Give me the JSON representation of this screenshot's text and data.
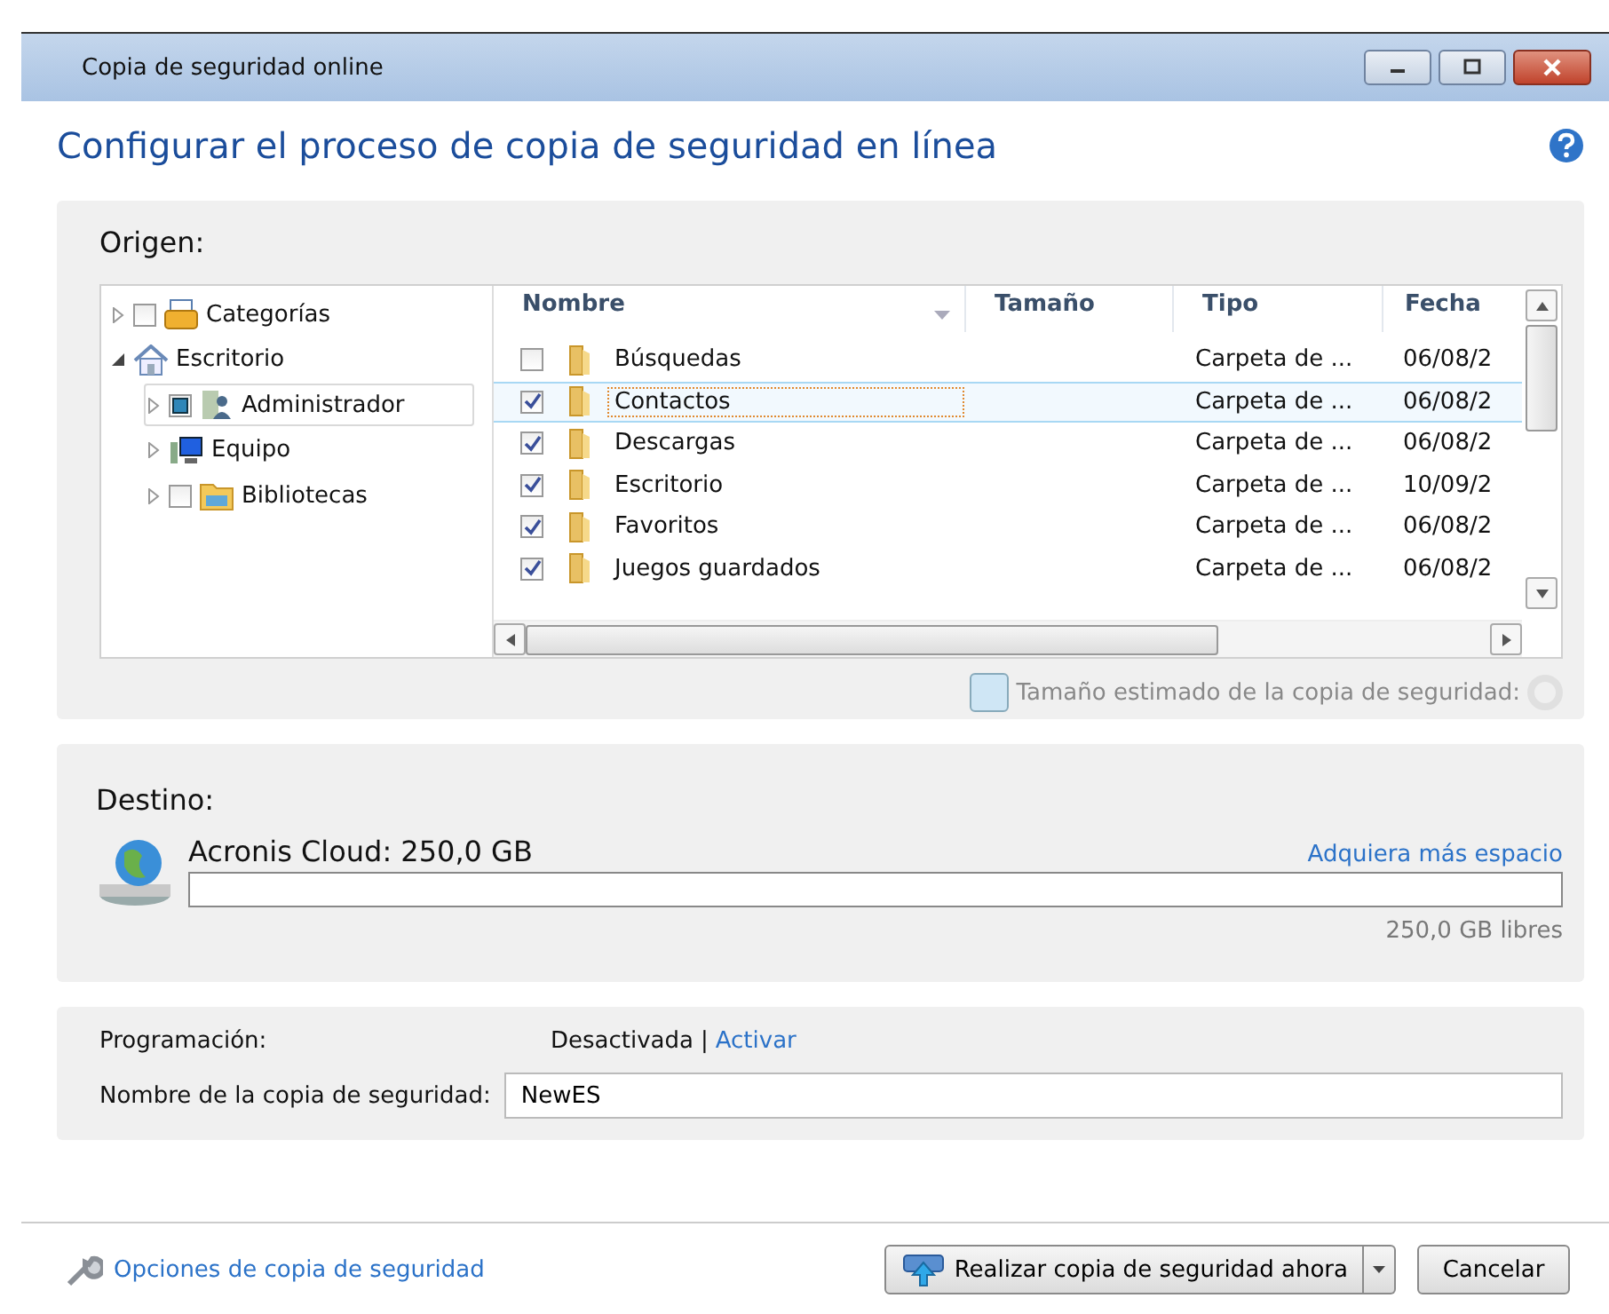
{
  "window": {
    "title": "Copia de seguridad online"
  },
  "heading": "Configurar el proceso de copia de seguridad en línea",
  "source": {
    "label": "Origen:",
    "tree": [
      {
        "label": "Categorías",
        "kind": "checkbox",
        "checked": false,
        "partial": false,
        "expanded": false,
        "selected": false
      },
      {
        "label": "Escritorio",
        "kind": "plain",
        "expanded": true,
        "selected": false,
        "children": [
          {
            "label": "Administrador",
            "kind": "checkbox",
            "checked": false,
            "partial": true,
            "expanded": false,
            "selected": true
          },
          {
            "label": "Equipo",
            "kind": "plain",
            "expanded": false,
            "selected": false
          },
          {
            "label": "Bibliotecas",
            "kind": "checkbox",
            "checked": false,
            "partial": false,
            "expanded": false,
            "selected": false
          }
        ]
      }
    ],
    "columns": [
      "Nombre",
      "Tamaño",
      "Tipo",
      "Fecha"
    ],
    "rows": [
      {
        "name": "Búsquedas",
        "checked": false,
        "selected": false,
        "type": "Carpeta de ...",
        "date": "06/08/2"
      },
      {
        "name": "Contactos",
        "checked": true,
        "selected": true,
        "type": "Carpeta de ...",
        "date": "06/08/2"
      },
      {
        "name": "Descargas",
        "checked": true,
        "selected": false,
        "type": "Carpeta de ...",
        "date": "06/08/2"
      },
      {
        "name": "Escritorio",
        "checked": true,
        "selected": false,
        "type": "Carpeta de ...",
        "date": "10/09/2"
      },
      {
        "name": "Favoritos",
        "checked": true,
        "selected": false,
        "type": "Carpeta de ...",
        "date": "06/08/2"
      },
      {
        "name": "Juegos guardados",
        "checked": true,
        "selected": false,
        "type": "Carpeta de ...",
        "date": "06/08/2"
      }
    ],
    "estimate": {
      "label": "Tamaño estimado de la copia de seguridad:",
      "disabled": true
    }
  },
  "destination": {
    "label": "Destino:",
    "name": "Acronis Cloud: 250,0 GB",
    "link": "Adquiera más espacio",
    "level": 0,
    "free": "250,0 GB libres"
  },
  "schedule": {
    "label": "Programación:",
    "status": "Desactivada",
    "separator": "|",
    "link": "Activar"
  },
  "backup_name": {
    "label": "Nombre de la copia de seguridad:",
    "value": "NewES"
  },
  "footer": {
    "options_link": "Opciones de copia de seguridad",
    "primary_button": "Realizar copia de seguridad ahora",
    "cancel_button": "Cancelar"
  }
}
